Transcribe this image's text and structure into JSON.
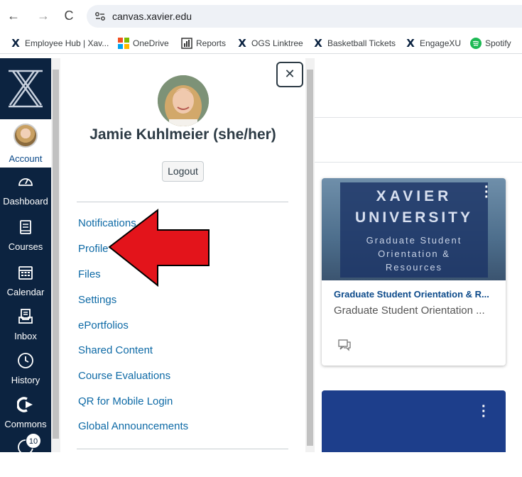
{
  "browser": {
    "back_icon": "arrow-left-icon",
    "forward_icon": "arrow-right-icon",
    "reload_icon": "reload-icon",
    "url": "canvas.xavier.edu"
  },
  "bookmarks": [
    {
      "label": "Employee Hub | Xav...",
      "icon": "xavier-x"
    },
    {
      "label": "OneDrive",
      "icon": "microsoft-logo"
    },
    {
      "label": "Reports",
      "icon": "chart-icon"
    },
    {
      "label": "OGS Linktree",
      "icon": "xavier-x"
    },
    {
      "label": "Basketball Tickets",
      "icon": "xavier-x"
    },
    {
      "label": "EngageXU",
      "icon": "xavier-x"
    },
    {
      "label": "Spotify",
      "icon": "spotify-logo"
    }
  ],
  "global_nav": {
    "account": "Account",
    "dashboard": "Dashboard",
    "courses": "Courses",
    "calendar": "Calendar",
    "inbox": "Inbox",
    "history": "History",
    "commons": "Commons",
    "badge_count": "10"
  },
  "tray": {
    "user_name": "Jamie Kuhlmeier (she/her)",
    "logout": "Logout",
    "close_icon": "close-icon",
    "links": [
      "Notifications",
      "Profile",
      "Files",
      "Settings",
      "ePortfolios",
      "Shared Content",
      "Course Evaluations",
      "QR for Mobile Login",
      "Global Announcements"
    ]
  },
  "dashboard": {
    "card": {
      "hero_line1": "XAVIER",
      "hero_line2": "UNIVERSITY",
      "hero_line3": "Graduate Student",
      "hero_line4": "Orientation &",
      "hero_line5": "Resources",
      "title": "Graduate Student Orientation & R...",
      "subtitle": "Graduate Student Orientation ..."
    }
  },
  "colors": {
    "nav_bg": "#0c2340",
    "link": "#0e6aa6",
    "arrow": "#e3141b"
  }
}
